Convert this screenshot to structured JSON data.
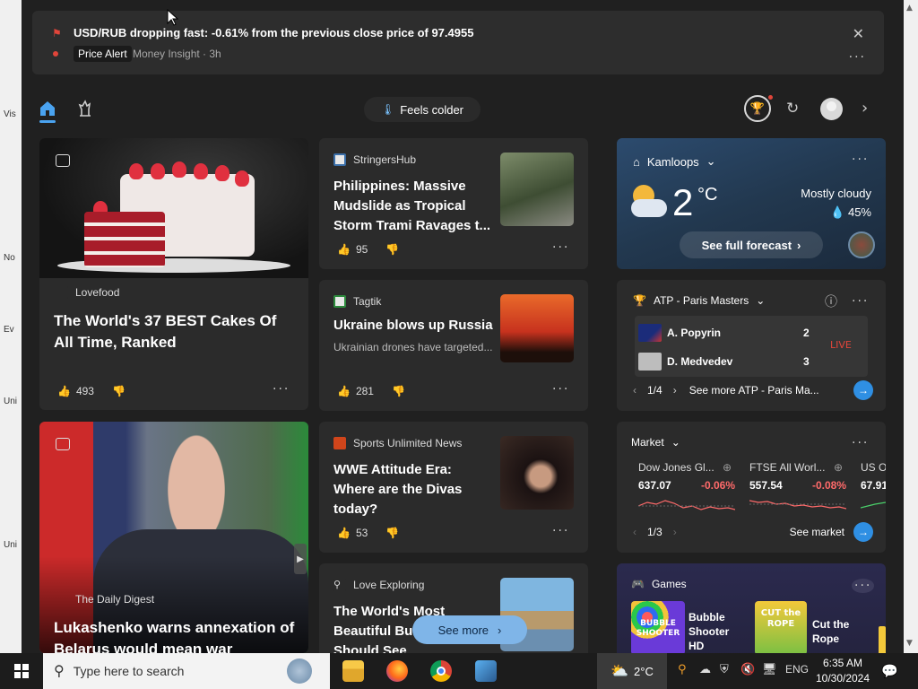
{
  "alert": {
    "title": "USD/RUB dropping fast: -0.61% from the previous close price of 97.4955",
    "badge": "Price Alert",
    "meta": "Money Insight · 3h"
  },
  "nav": {
    "feels": "Feels colder"
  },
  "cards": {
    "cake": {
      "source": "Lovefood",
      "headline": "The World's 37 BEST Cakes Of All Time, Ranked",
      "likes": "493"
    },
    "philippines": {
      "source": "StringersHub",
      "headline": "Philippines: Massive Mudslide as Tropical Storm Trami Ravages t...",
      "likes": "95"
    },
    "ukraine": {
      "source": "Tagtik",
      "headline": "Ukraine blows up Russia",
      "snippet": "Ukrainian drones have targeted...",
      "likes": "281"
    },
    "wwe": {
      "source": "Sports Unlimited News",
      "headline": "WWE Attitude Era: Where are the Divas today?",
      "likes": "53"
    },
    "lukashenko": {
      "source": "The Daily Digest",
      "headline": "Lukashenko warns annexation of Belarus would mean war"
    },
    "castles": {
      "source": "Love Exploring",
      "headline": "The World's Most Beautiful Bu... Everyone Should See"
    }
  },
  "weather": {
    "location": "Kamloops",
    "temp": "2",
    "unit": "°C",
    "condition": "Mostly cloudy",
    "humidity": "45%",
    "forecast_btn": "See full forecast"
  },
  "atp": {
    "title": "ATP - Paris Masters",
    "players": [
      {
        "name": "A. Popyrin",
        "score": "2"
      },
      {
        "name": "D. Medvedev",
        "score": "3"
      }
    ],
    "live": "LIVE",
    "page": "1/4",
    "see_more": "See more ATP - Paris Ma..."
  },
  "market": {
    "title": "Market",
    "items": [
      {
        "name": "Dow Jones Gl...",
        "value": "637.07",
        "change": "-0.06%"
      },
      {
        "name": "FTSE All Worl...",
        "value": "557.54",
        "change": "-0.08%"
      },
      {
        "name": "US O",
        "value": "67.91",
        "change": ""
      }
    ],
    "page": "1/3",
    "see_market": "See market"
  },
  "games": {
    "title": "Games",
    "items": [
      {
        "name": "Bubble Shooter HD",
        "thumb": "BUBBLE SHOOTER"
      },
      {
        "name": "Cut the Rope",
        "thumb": "CUT the ROPE"
      }
    ]
  },
  "see_more": "See more",
  "desktop_labels": [
    "Vis",
    "No",
    "Ev",
    "Uni",
    "Uni"
  ],
  "taskbar": {
    "search_placeholder": "Type here to search",
    "weather_temp": "2°C",
    "lang": "ENG",
    "time": "6:35 AM",
    "date": "10/30/2024"
  },
  "colors": {
    "accent": "#2f8fe3",
    "negative": "#ff6a6a",
    "alert": "#e0453a"
  }
}
